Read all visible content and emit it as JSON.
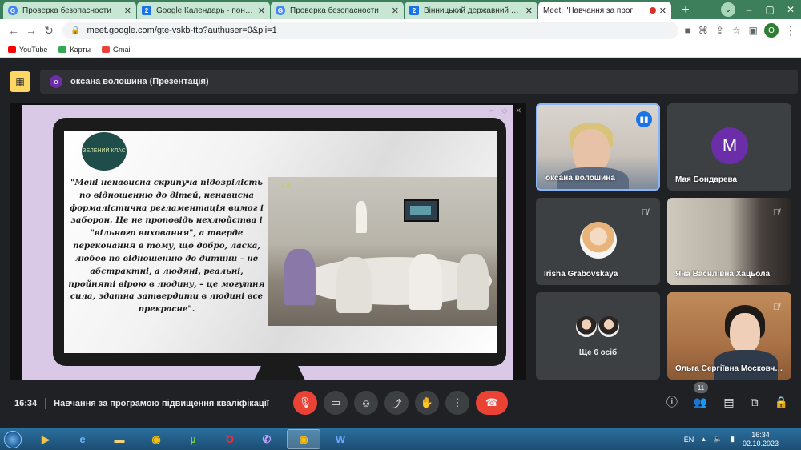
{
  "browser": {
    "tabs": [
      {
        "title": "Проверка безопасности",
        "icon": "google-icon"
      },
      {
        "title": "Google Календарь - понеделы",
        "icon": "calendar-icon"
      },
      {
        "title": "Проверка безопасности",
        "icon": "google-icon"
      },
      {
        "title": "Вінницький державний педа",
        "icon": "calendar-icon"
      },
      {
        "title": "Meet: \"Навчання за прог",
        "icon": "meet-icon",
        "active": true
      }
    ],
    "url": "meet.google.com/gte-vskb-ttb?authuser=0&pli=1",
    "profile_initial": "O",
    "bookmarks": [
      {
        "label": "YouTube",
        "color": "#ff0000"
      },
      {
        "label": "Карты",
        "color": "#34a853"
      },
      {
        "label": "Gmail",
        "color": "#ea4335"
      }
    ]
  },
  "meet": {
    "presenter_initial": "о",
    "presenter_label": "оксана волошина (Презентація)",
    "slide": {
      "badge_text": "ЗЕЛЕНИЙ КЛАС",
      "quote": "\"Мені ненависна скрипуча підозрілість по відношенню до дітей, ненависна формалістична регламентація вимог і заборон. Це не проповідь нехлюйства і \"вільного виховання\", а тверде переконання в тому, що добро, ласка, любов по відношенню до дитини – не абстрактні, а людяні, реальні, пройняті вірою в людину, – це могутня сила, здатна затвердити в людині все прекрасне\".",
      "photo_logo": "СК"
    },
    "participants": [
      {
        "name": "оксана волошина",
        "state": "speaking"
      },
      {
        "name": "Мая Бондарева",
        "initial": "М"
      },
      {
        "name": "Irisha Grabovskaya",
        "state": "muted"
      },
      {
        "name": "Яна Василівна Хацьола",
        "state": "muted"
      },
      {
        "name": "Ольга Сергіївна Московченко",
        "state": "muted"
      }
    ],
    "more_label": "Ще 6 осіб",
    "time": "16:34",
    "meeting_name": "Навчання за програмою підвищення кваліфікації",
    "people_count": "11"
  },
  "taskbar": {
    "lang": "EN",
    "time": "16:34",
    "date": "02.10.2023"
  },
  "colors": {
    "accent": "#1a73e8",
    "end_call": "#ea4335",
    "presenter_avatar": "#6b2da8"
  }
}
